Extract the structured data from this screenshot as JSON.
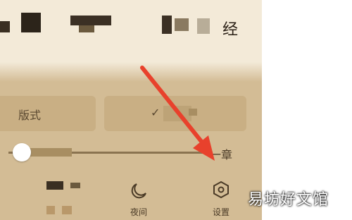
{
  "header": {
    "visible_char": "经"
  },
  "controls": {
    "left_button_label": "版式",
    "right_button_label": "✓",
    "next_chapter_label": "一章"
  },
  "tabbar": {
    "night_label": "夜间",
    "settings_label": "设置"
  },
  "watermark": {
    "text": "易坊好文馆"
  },
  "colors": {
    "background": "#d3bc95",
    "header_background": "#f3ead8",
    "arrow": "#e8412c"
  },
  "icons": {
    "night": "moon-icon",
    "settings": "hexagon-gear-icon"
  }
}
